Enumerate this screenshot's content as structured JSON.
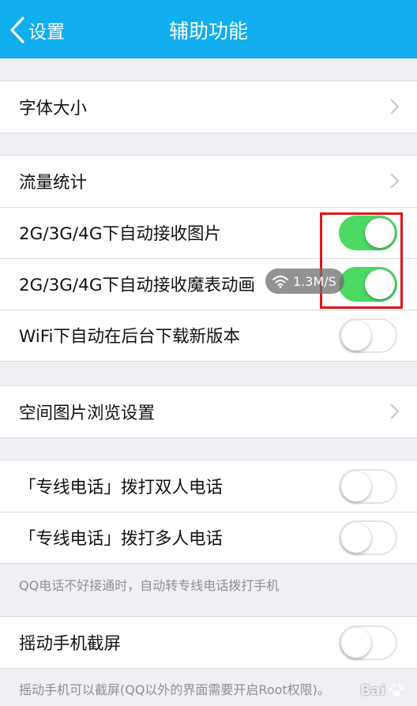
{
  "nav": {
    "back_label": "设置",
    "title": "辅助功能"
  },
  "groups": [
    {
      "items": [
        {
          "label": "字体大小",
          "control": "chevron"
        }
      ]
    },
    {
      "items": [
        {
          "label": "流量统计",
          "control": "chevron"
        },
        {
          "label": "2G/3G/4G下自动接收图片",
          "control": "toggle",
          "on": true
        },
        {
          "label": "2G/3G/4G下自动接收魔表动画",
          "control": "toggle",
          "on": true
        },
        {
          "label": "WiFi下自动在后台下载新版本",
          "control": "toggle",
          "on": false
        }
      ]
    },
    {
      "items": [
        {
          "label": "空间图片浏览设置",
          "control": "chevron"
        }
      ]
    },
    {
      "items": [
        {
          "label": "「专线电话」拨打双人电话",
          "control": "toggle",
          "on": false
        },
        {
          "label": "「专线电话」拨打多人电话",
          "control": "toggle",
          "on": false
        }
      ]
    },
    {
      "items": [
        {
          "label": "摇动手机截屏",
          "control": "toggle",
          "on": false
        }
      ]
    }
  ],
  "footnotes": {
    "phone": "QQ电话不好接通时，自动转专线电话拨打手机",
    "shake": "摇动手机可以截屏(QQ以外的界面需要开启Root权限)。"
  },
  "overlay": {
    "network_speed": "1.3M/S",
    "watermark": "Bai"
  },
  "colors": {
    "nav_bar": "#10aeef",
    "toggle_on": "#4cd964",
    "highlight_box": "#e0141b",
    "background": "#efeff4"
  },
  "icons": {
    "back": "chevron-left-icon",
    "disclosure": "chevron-right-icon",
    "wifi": "wifi-icon",
    "watermark": "paw-icon"
  }
}
